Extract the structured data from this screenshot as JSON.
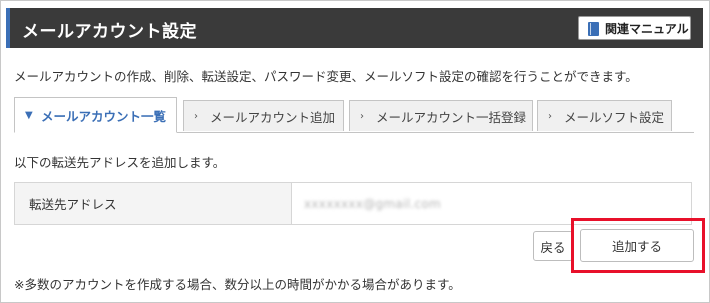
{
  "header": {
    "title": "メールアカウント設定",
    "manual_button_label": "関連マニュアル",
    "manual_icon": "book-icon",
    "accent_color": "#3b6fb6"
  },
  "description": "メールアカウントの作成、削除、転送設定、パスワード変更、メールソフト設定の確認を行うことができます。",
  "tabs": [
    {
      "label": "メールアカウント一覧",
      "active": true
    },
    {
      "label": "メールアカウント追加",
      "active": false
    },
    {
      "label": "メールアカウント一括登録",
      "active": false
    },
    {
      "label": "メールソフト設定",
      "active": false
    }
  ],
  "form": {
    "instruction": "以下の転送先アドレスを追加します。",
    "field_label": "転送先アドレス",
    "field_value": "xxxxxxxx@gmail.com"
  },
  "buttons": {
    "back_label": "戻る",
    "submit_label": "追加する"
  },
  "highlight_color": "#e8102a",
  "note": "※多数のアカウントを作成する場合、数分以上の時間がかかる場合があります。"
}
